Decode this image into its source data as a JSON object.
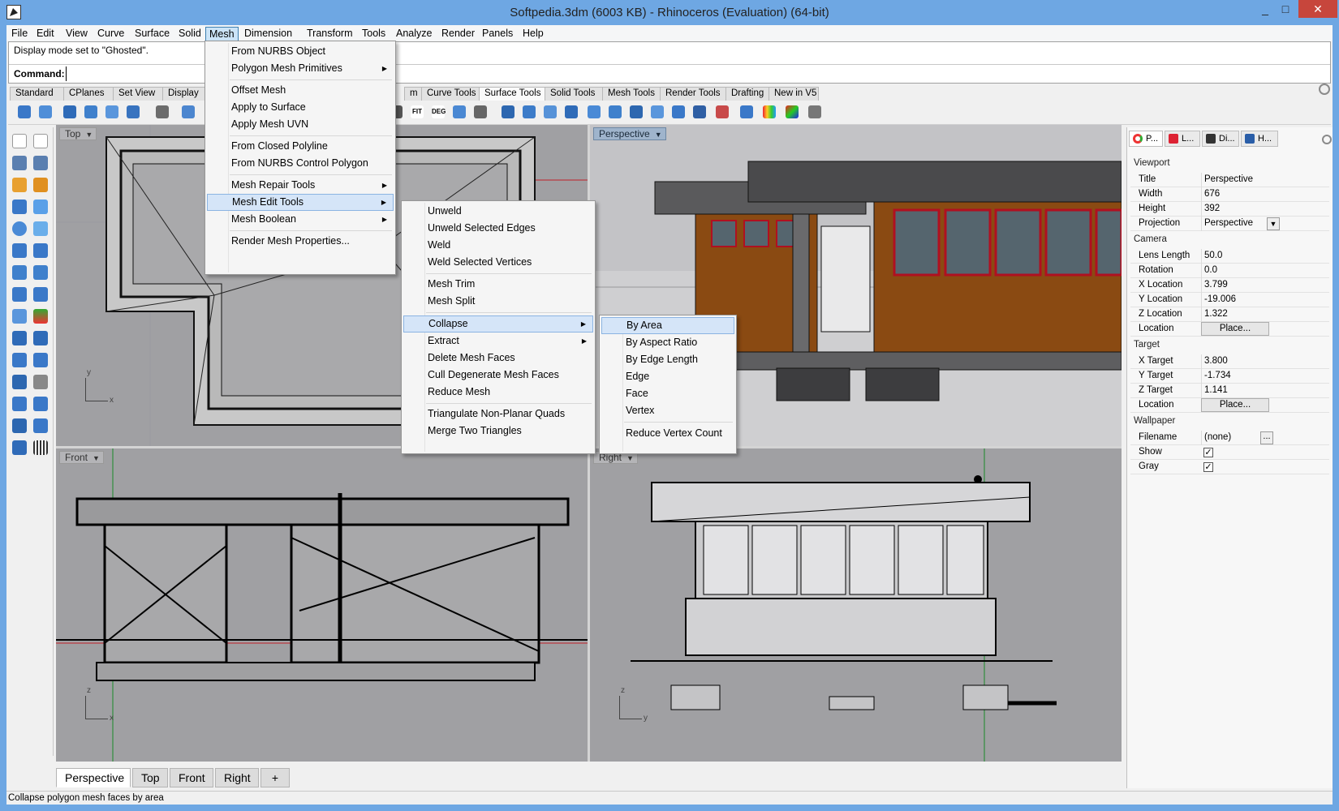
{
  "window": {
    "title": "Softpedia.3dm (6003 KB) - Rhinoceros (Evaluation) (64-bit)",
    "min": "_",
    "max": "□",
    "close": "✕"
  },
  "menubar": [
    "File",
    "Edit",
    "View",
    "Curve",
    "Surface",
    "Solid",
    "Mesh",
    "Dimension",
    "Transform",
    "Tools",
    "Analyze",
    "Render",
    "Panels",
    "Help"
  ],
  "command": {
    "history": "Display mode set to \"Ghosted\".",
    "label": "Command:",
    "value": ""
  },
  "toolbar_tabs": [
    "Standard",
    "CPlanes",
    "Set View",
    "Display",
    "m",
    "Curve Tools",
    "Surface Tools",
    "Solid Tools",
    "Mesh Tools",
    "Render Tools",
    "Drafting",
    "New in V5"
  ],
  "toolbar_icon_text": {
    "fit": "FIT",
    "deg": "DEG"
  },
  "mesh_menu": {
    "items": [
      "From NURBS Object",
      "Polygon Mesh Primitives",
      "Offset Mesh",
      "Apply to Surface",
      "Apply Mesh UVN",
      "From Closed Polyline",
      "From NURBS Control Polygon",
      "Mesh Repair Tools",
      "Mesh Edit Tools",
      "Mesh Boolean",
      "Render Mesh Properties..."
    ],
    "submenu_arrow": "▶"
  },
  "mesh_edit_menu": {
    "items": [
      "Unweld",
      "Unweld Selected Edges",
      "Weld",
      "Weld Selected Vertices",
      "Mesh Trim",
      "Mesh Split",
      "Collapse",
      "Extract",
      "Delete Mesh Faces",
      "Cull Degenerate Mesh Faces",
      "Reduce Mesh",
      "Triangulate Non-Planar Quads",
      "Merge Two Triangles"
    ]
  },
  "collapse_menu": {
    "items": [
      "By Area",
      "By Aspect Ratio",
      "By Edge Length",
      "Edge",
      "Face",
      "Vertex",
      "Reduce Vertex Count"
    ]
  },
  "viewports": {
    "top": "Top",
    "perspective": "Perspective",
    "front": "Front",
    "right": "Right",
    "axes": {
      "x": "x",
      "y": "y",
      "z": "z"
    }
  },
  "viewport_tabs": [
    "Perspective",
    "Top",
    "Front",
    "Right",
    "+"
  ],
  "status": "Collapse polygon mesh faces by area",
  "properties": {
    "tabs": [
      "P...",
      "L...",
      "Di...",
      "H..."
    ],
    "viewport_header": "Viewport",
    "title_k": "Title",
    "title_v": "Perspective",
    "width_k": "Width",
    "width_v": "676",
    "height_k": "Height",
    "height_v": "392",
    "projection_k": "Projection",
    "projection_v": "Perspective",
    "camera_header": "Camera",
    "lens_k": "Lens Length",
    "lens_v": "50.0",
    "rot_k": "Rotation",
    "rot_v": "0.0",
    "xloc_k": "X Location",
    "xloc_v": "3.799",
    "yloc_k": "Y Location",
    "yloc_v": "-19.006",
    "zloc_k": "Z Location",
    "zloc_v": "1.322",
    "loc_k": "Location",
    "place_btn": "Place...",
    "target_header": "Target",
    "xt_k": "X Target",
    "xt_v": "3.800",
    "yt_k": "Y Target",
    "yt_v": "-1.734",
    "zt_k": "Z Target",
    "zt_v": "1.141",
    "tloc_k": "Location",
    "wall_header": "Wallpaper",
    "file_k": "Filename",
    "file_v": "(none)",
    "show_k": "Show",
    "gray_k": "Gray",
    "check": "✓",
    "dots": "...",
    "dd": "▼"
  },
  "colors": {
    "accent": "#6ea7e3",
    "highlight": "#d5e5f8",
    "axis_red": "#c0202a",
    "axis_green": "#1a8a2a"
  }
}
